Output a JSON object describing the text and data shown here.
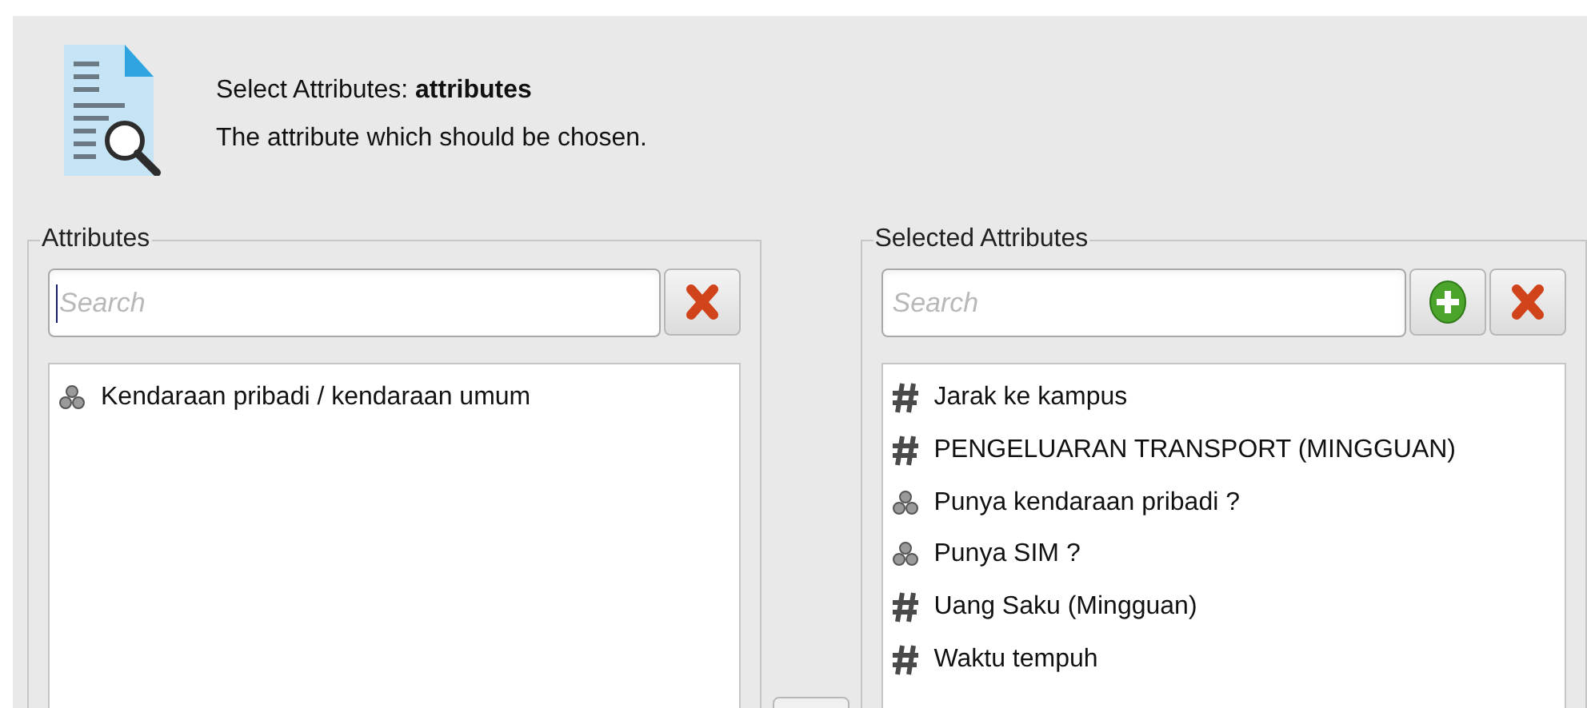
{
  "header": {
    "title": "Select Attributes: **attributes**",
    "description": "The attribute which should be chosen."
  },
  "attributes": {
    "legend": "Attributes",
    "search": {
      "placeholder": "Search"
    },
    "items": [
      {
        "label": "Kendaraan pribadi / kendaraan umum",
        "kind": "nominal"
      }
    ]
  },
  "selected_attributes": {
    "legend": "Selected Attributes",
    "search": {
      "placeholder": "Search"
    },
    "items": [
      {
        "label": "Jarak ke kampus",
        "kind": "numeric"
      },
      {
        "label": "PENGELUARAN TRANSPORT (MINGGUAN)",
        "kind": "numeric"
      },
      {
        "label": "Punya kendaraan pribadi ?",
        "kind": "nominal"
      },
      {
        "label": "Punya SIM ?",
        "kind": "nominal"
      },
      {
        "label": "Uang Saku (Mingguan)",
        "kind": "numeric"
      },
      {
        "label": "Waktu tempuh",
        "kind": "numeric"
      }
    ]
  }
}
